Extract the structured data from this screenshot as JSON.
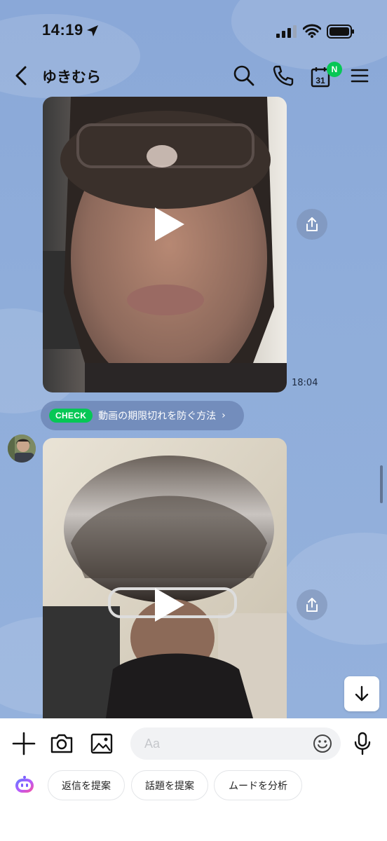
{
  "status_bar": {
    "time": "14:19"
  },
  "header": {
    "title": "ゆきむら",
    "calendar_day": "31",
    "calendar_badge": "N"
  },
  "messages": [
    {
      "type": "video",
      "time": "18:04"
    },
    {
      "type": "video"
    }
  ],
  "check_banner": {
    "tag": "CHECK",
    "text": "動画の期限切れを防ぐ方法",
    "chevron": "›"
  },
  "input": {
    "placeholder": "Aa",
    "value": ""
  },
  "suggestions": [
    {
      "label": "返信を提案"
    },
    {
      "label": "話題を提案"
    },
    {
      "label": "ムードを分析"
    }
  ],
  "icons": {
    "status": [
      "location-arrow-icon",
      "signal-icon",
      "wifi-icon",
      "battery-icon"
    ],
    "header": [
      "back-icon",
      "search-icon",
      "phone-icon",
      "calendar-icon",
      "menu-icon"
    ],
    "toolbar": [
      "plus-icon",
      "camera-icon",
      "image-icon",
      "emoji-icon",
      "mic-icon"
    ]
  },
  "colors": {
    "chat_background": "#8fabd8",
    "check_green": "#06c755",
    "badge_green": "#06c755"
  }
}
